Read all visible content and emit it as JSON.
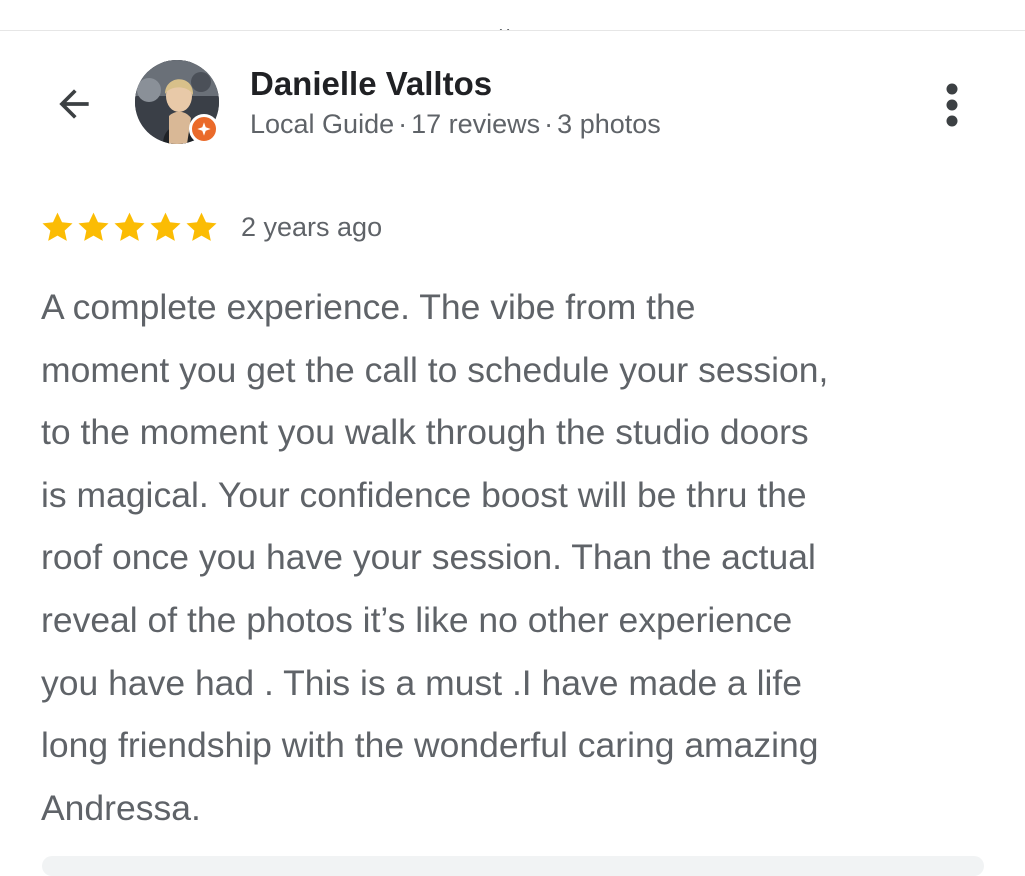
{
  "top_strip": {
    "cut_text": "ᵧ"
  },
  "header": {
    "back_icon": "arrow-left-icon",
    "more_icon": "more-vert-icon",
    "badge_icon": "local-guide-badge-icon",
    "reviewer_name": "Danielle Valltos",
    "reviewer_level": "Local Guide",
    "separator": "·",
    "reviews_count": "17 reviews",
    "photos_count": "3 photos"
  },
  "review": {
    "stars": 5,
    "star_color": "#fbbc04",
    "age": "2 years ago",
    "text": "A complete experience. The vibe from the\nmoment you get the call to schedule your session,\nto the moment you walk through the studio doors\nis magical. Your confidence boost will be thru the\nroof once you have your session. Than the actual\nreveal of the photos it’s like no other experience\nyou have had . This is a must .I have made a life\nlong friendship with the wonderful caring amazing\nAndressa."
  },
  "colors": {
    "badge": "#ea6a2a",
    "primary_text": "#202124",
    "secondary_text": "#5f6368"
  }
}
